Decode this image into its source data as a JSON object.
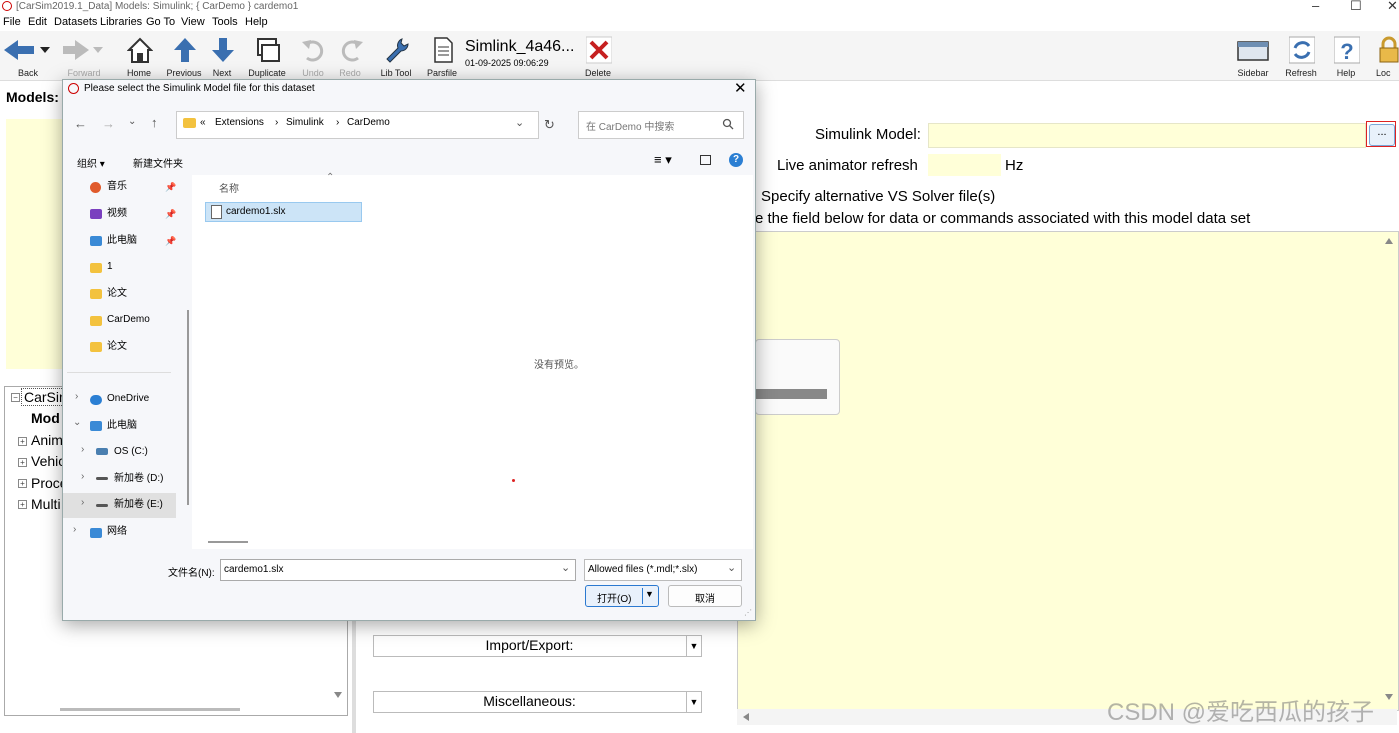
{
  "window": {
    "title": "[CarSim2019.1_Data] Models: Simulink; { CarDemo } cardemo1",
    "minimize_glyph": "–",
    "maximize_glyph": "☐",
    "close_glyph": "✕"
  },
  "menu": [
    "File",
    "Edit",
    "Datasets",
    "Libraries",
    "Go To",
    "View",
    "Tools",
    "Help"
  ],
  "toolbar": {
    "back": "Back",
    "forward": "Forward",
    "home": "Home",
    "previous": "Previous",
    "next": "Next",
    "duplicate": "Duplicate",
    "undo": "Undo",
    "redo": "Redo",
    "lib_tool": "Lib Tool",
    "parsfile": "Parsfile",
    "dataset_name": "Simlink_4a46...",
    "dataset_date": "01-09-2025 09:06:29",
    "delete": "Delete",
    "sidebar": "Sidebar",
    "refresh": "Refresh",
    "help": "Help",
    "lock": "Loc"
  },
  "left_panel": {
    "models_label": "Models:",
    "tree": {
      "root": "CarSin",
      "selected": "Mod",
      "items": [
        "Anim",
        "Vehic",
        "Proce",
        "Multi"
      ]
    }
  },
  "right_panel": {
    "simulink_model_label": "Simulink Model:",
    "simulink_model_value": "",
    "browse_button": "...",
    "live_animator_label": "Live animator refresh",
    "live_animator_value": "",
    "hz_unit": "Hz",
    "alt_solver_label": "Specify alternative VS Solver file(s)",
    "notes_label": "e the field below  for data or commands associated with this model data set",
    "import_export": "Import/Export:",
    "miscellaneous": "Miscellaneous:"
  },
  "dialog": {
    "title": "Please select the Simulink Model file for this dataset",
    "close_glyph": "✕",
    "path": [
      "«",
      "Extensions",
      "Simulink",
      "CarDemo"
    ],
    "search_placeholder": "在 CarDemo 中搜索",
    "organize": "组织 ▾",
    "new_folder": "新建文件夹",
    "nav_items": [
      {
        "label": "音乐",
        "pinned": true
      },
      {
        "label": "视频",
        "pinned": true
      },
      {
        "label": "此电脑",
        "pinned": true
      },
      {
        "label": "1",
        "pinned": false
      },
      {
        "label": "论文",
        "pinned": false
      },
      {
        "label": "CarDemo",
        "pinned": false
      },
      {
        "label": "论文",
        "pinned": false
      },
      {
        "label": "OneDrive",
        "pinned": false
      },
      {
        "label": "此电脑",
        "pinned": false
      },
      {
        "label": "OS (C:)",
        "pinned": false
      },
      {
        "label": "新加卷 (D:)",
        "pinned": false
      },
      {
        "label": "新加卷 (E:)",
        "pinned": false
      },
      {
        "label": "网络",
        "pinned": false
      }
    ],
    "column_name": "名称",
    "files": [
      "cardemo1.slx"
    ],
    "no_preview": "没有预览。",
    "filename_label": "文件名(N):",
    "filename_value": "cardemo1.slx",
    "filetype_value": "Allowed files (*.mdl;*.slx)",
    "open_button": "打开(O)",
    "cancel_button": "取消"
  },
  "watermark": "CSDN @爱吃西瓜的孩子",
  "colors": {
    "yellow_field": "#ffffd8",
    "highlight_red": "#dd2222",
    "selection_blue": "#cce4f7"
  }
}
